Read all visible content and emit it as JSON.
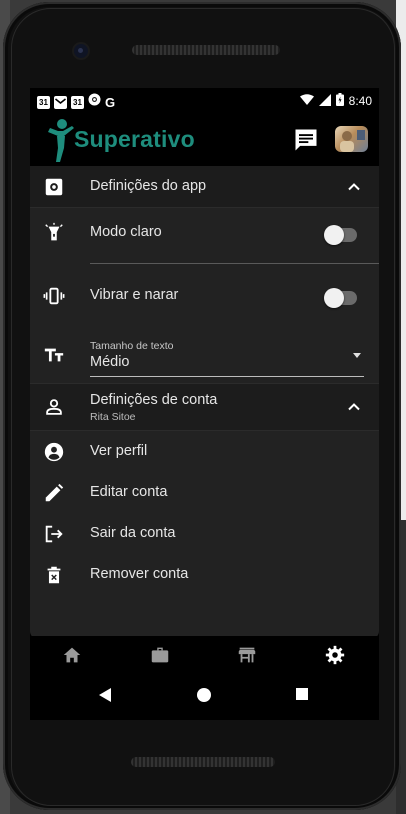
{
  "status_bar": {
    "notifications": [
      "31",
      "31"
    ],
    "time": "8:40"
  },
  "app": {
    "brand": "Superativo",
    "colors": {
      "brand": "#1e8d7d",
      "background": "#000000",
      "surface": "#222222"
    }
  },
  "app_settings": {
    "title": "Definições do app",
    "light_mode_label": "Modo claro",
    "light_mode_enabled": false,
    "vibrate_label": "Vibrar e narar",
    "vibrate_enabled": false,
    "text_size_label": "Tamanho de texto",
    "text_size_value": "Médio"
  },
  "account_settings": {
    "title": "Definições de conta",
    "user_name": "Rita Sitoe",
    "items": [
      {
        "label": "Ver perfil",
        "icon": "account-circle-icon"
      },
      {
        "label": "Editar conta",
        "icon": "pencil-icon"
      },
      {
        "label": "Sair da conta",
        "icon": "logout-icon"
      },
      {
        "label": "Remover conta",
        "icon": "trash-icon"
      }
    ]
  },
  "bottom_nav": {
    "items": [
      "home-icon",
      "briefcase-icon",
      "store-icon",
      "settings-icon"
    ],
    "active": "settings-icon"
  },
  "system_nav": [
    "back-icon",
    "home-circle-icon",
    "overview-icon"
  ]
}
